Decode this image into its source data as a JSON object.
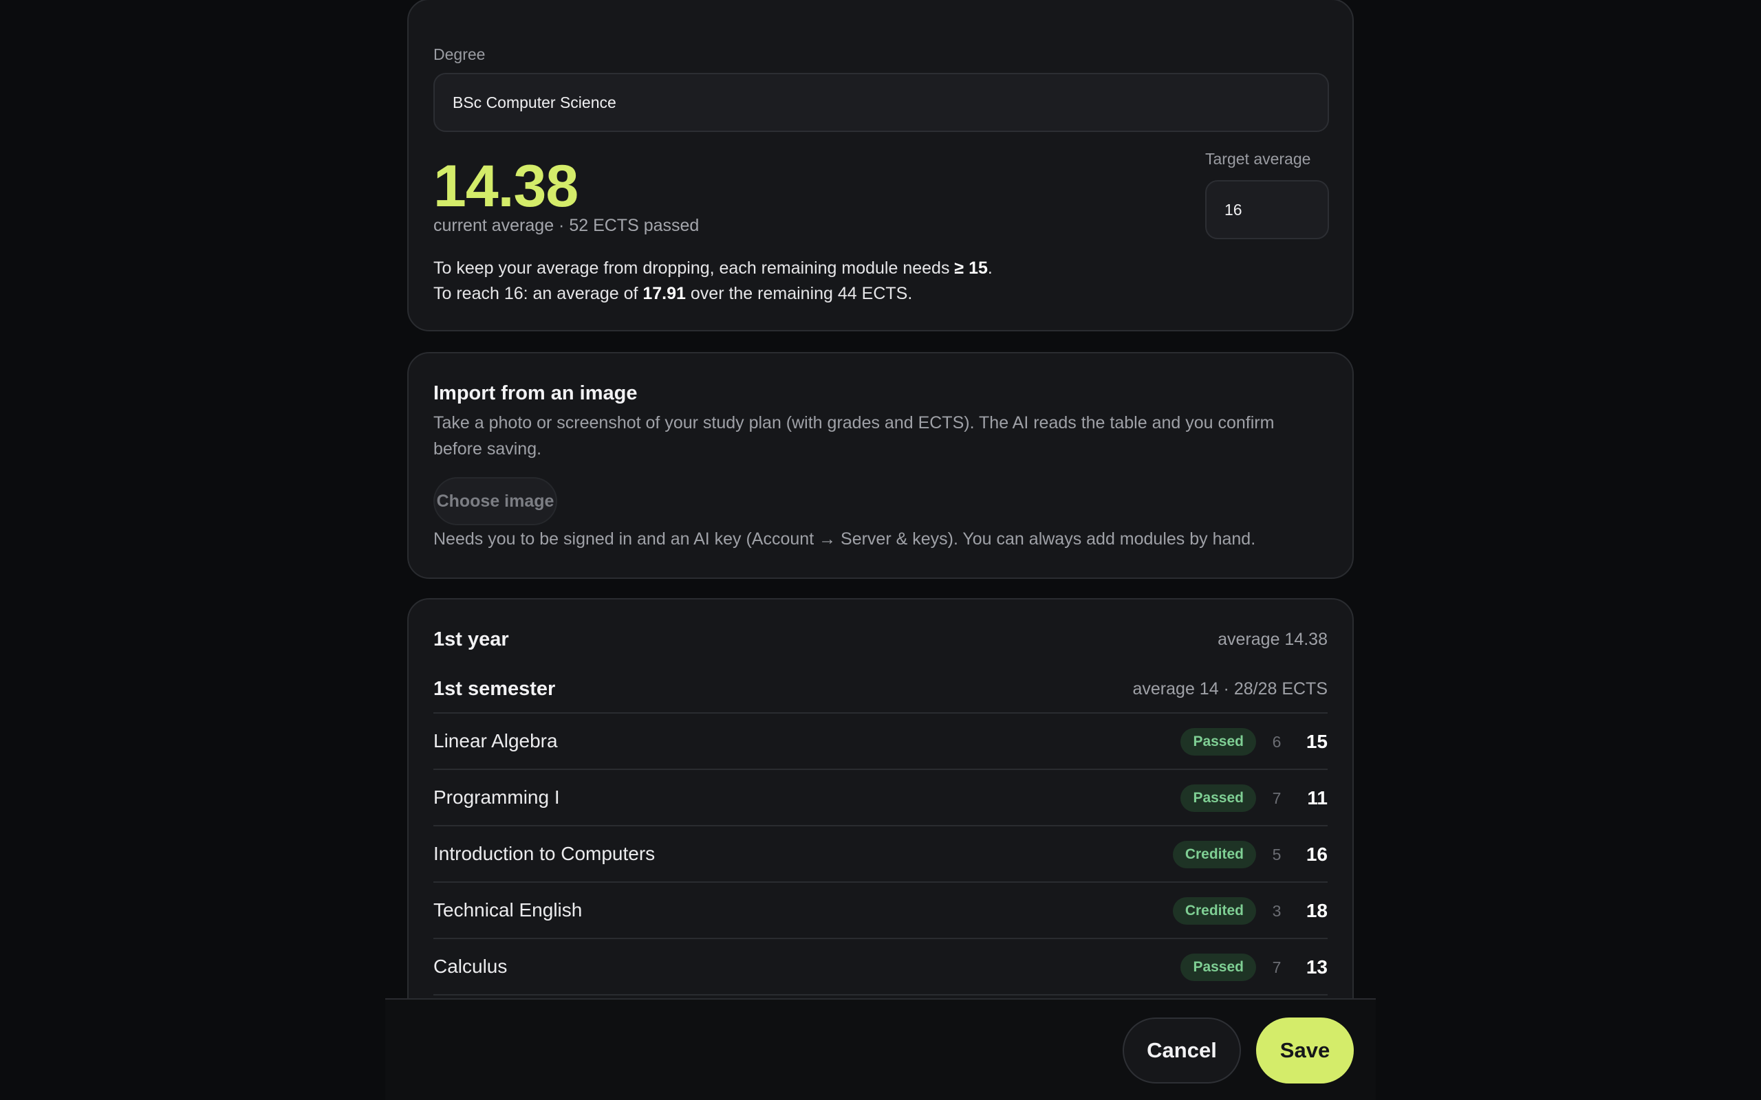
{
  "degree": {
    "label": "Degree",
    "value": "BSc Computer Science",
    "current_average": "14.38",
    "subtitle": "current average · 52 ECTS passed",
    "target_label": "Target average",
    "target_value": "16",
    "need_line1_prefix": "To keep your average from dropping, each remaining module needs ",
    "need_line1_value": "≥ 15",
    "need_line1_suffix": ".",
    "need_line2_prefix": "To reach 16: an average of ",
    "need_line2_value": "17.91",
    "need_line2_suffix": " over the remaining 44 ECTS."
  },
  "import": {
    "title": "Import from an image",
    "description": "Take a photo or screenshot of your study plan (with grades and ECTS). The AI reads the table and you confirm before saving.",
    "button_label": "Choose image",
    "note": "Needs you to be signed in and an AI key (Account → Server & keys). You can always add modules by hand."
  },
  "year": {
    "title": "1st year",
    "average": "average 14.38",
    "semester": {
      "title": "1st semester",
      "summary": "average 14 · 28/28 ECTS",
      "modules": [
        {
          "name": "Linear Algebra",
          "status": "Passed",
          "ects": "6",
          "grade": "15"
        },
        {
          "name": "Programming I",
          "status": "Passed",
          "ects": "7",
          "grade": "11"
        },
        {
          "name": "Introduction to Computers",
          "status": "Credited",
          "ects": "5",
          "grade": "16"
        },
        {
          "name": "Technical English",
          "status": "Credited",
          "ects": "3",
          "grade": "18"
        },
        {
          "name": "Calculus",
          "status": "Passed",
          "ects": "7",
          "grade": "13"
        }
      ]
    }
  },
  "footer": {
    "cancel_label": "Cancel",
    "save_label": "Save"
  },
  "colors": {
    "accent": "#d4ec6a",
    "badge_bg": "#1e3325",
    "badge_text": "#7fcf94",
    "background": "#0b0c0e",
    "card": "#16171a"
  }
}
